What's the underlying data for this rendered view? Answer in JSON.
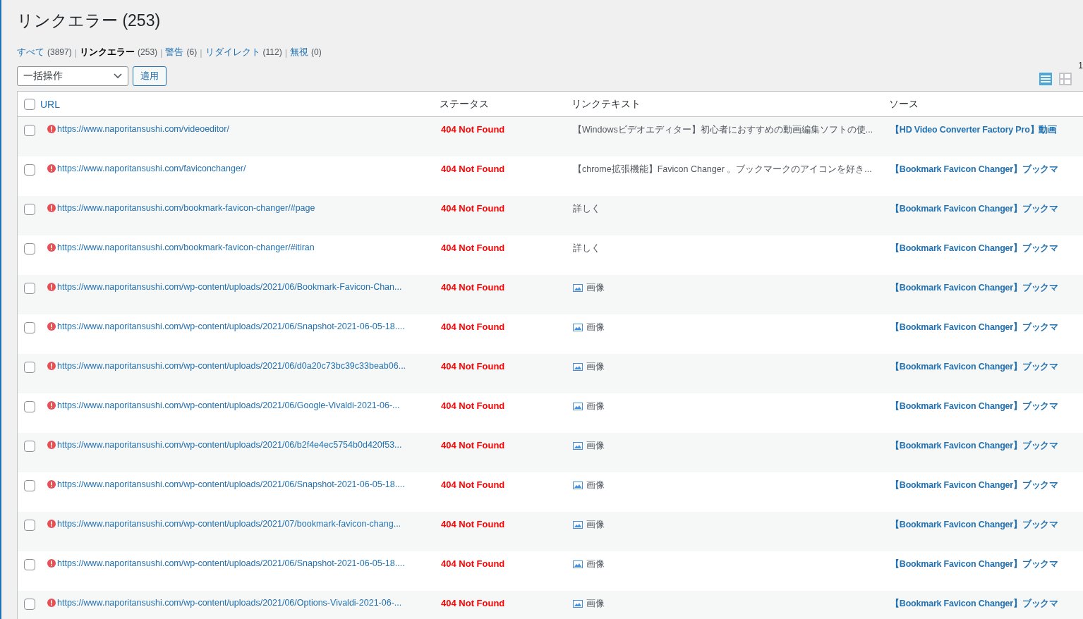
{
  "page_title": "リンクエラー (253)",
  "filters": [
    {
      "label": "すべて",
      "count": "(3897)",
      "selected": false
    },
    {
      "separator": "|",
      "label": "リンクエラー",
      "count": "(253)",
      "selected": true
    },
    {
      "separator": "|",
      "label": "警告",
      "count": "(6)",
      "selected": false
    },
    {
      "separator": "|",
      "label": "リダイレクト",
      "count": "(112)",
      "selected": false
    },
    {
      "separator": "|",
      "label": "無視",
      "count": "(0)",
      "selected": false
    }
  ],
  "bulk_action": {
    "value": "一括操作",
    "apply": "適用"
  },
  "view_modes": [
    {
      "kind": "list",
      "selected": true
    },
    {
      "kind": "excerpt",
      "selected": false
    }
  ],
  "corner_text": "1",
  "table": {
    "select_all_checked": false,
    "columns": [
      "URL",
      "ステータス",
      "リンクテキスト",
      "ソース"
    ],
    "rows": [
      {
        "checked": false,
        "url": "https://www.naporitansushi.com/videoeditor/",
        "status": "404 Not Found",
        "kind": "text",
        "link_text": "【Windowsビデオエディター】初心者におすすめの動画編集ソフトの使...",
        "source": "【HD Video Converter Factory Pro】動画"
      },
      {
        "checked": false,
        "url": "https://www.naporitansushi.com/faviconchanger/",
        "status": "404 Not Found",
        "kind": "text",
        "link_text": "【chrome拡張機能】Favicon Changer 。ブックマークのアイコンを好き...",
        "source": "【Bookmark Favicon Changer】ブックマ"
      },
      {
        "checked": false,
        "url": "https://www.naporitansushi.com/bookmark-favicon-changer/#page",
        "status": "404 Not Found",
        "kind": "text",
        "link_text": "詳しく",
        "source": "【Bookmark Favicon Changer】ブックマ"
      },
      {
        "checked": false,
        "url": "https://www.naporitansushi.com/bookmark-favicon-changer/#itiran",
        "status": "404 Not Found",
        "kind": "text",
        "link_text": "詳しく",
        "source": "【Bookmark Favicon Changer】ブックマ"
      },
      {
        "checked": false,
        "url": "https://www.naporitansushi.com/wp-content/uploads/2021/06/Bookmark-Favicon-Chan...",
        "status": "404 Not Found",
        "kind": "image",
        "link_text": "画像",
        "source": "【Bookmark Favicon Changer】ブックマ"
      },
      {
        "checked": false,
        "url": "https://www.naporitansushi.com/wp-content/uploads/2021/06/Snapshot-2021-06-05-18....",
        "status": "404 Not Found",
        "kind": "image",
        "link_text": "画像",
        "source": "【Bookmark Favicon Changer】ブックマ"
      },
      {
        "checked": false,
        "url": "https://www.naporitansushi.com/wp-content/uploads/2021/06/d0a20c73bc39c33beab06...",
        "status": "404 Not Found",
        "kind": "image",
        "link_text": "画像",
        "source": "【Bookmark Favicon Changer】ブックマ"
      },
      {
        "checked": false,
        "url": "https://www.naporitansushi.com/wp-content/uploads/2021/06/Google-Vivaldi-2021-06-...",
        "status": "404 Not Found",
        "kind": "image",
        "link_text": "画像",
        "source": "【Bookmark Favicon Changer】ブックマ"
      },
      {
        "checked": false,
        "url": "https://www.naporitansushi.com/wp-content/uploads/2021/06/b2f4e4ec5754b0d420f53...",
        "status": "404 Not Found",
        "kind": "image",
        "link_text": "画像",
        "source": "【Bookmark Favicon Changer】ブックマ"
      },
      {
        "checked": false,
        "url": "https://www.naporitansushi.com/wp-content/uploads/2021/06/Snapshot-2021-06-05-18....",
        "status": "404 Not Found",
        "kind": "image",
        "link_text": "画像",
        "source": "【Bookmark Favicon Changer】ブックマ"
      },
      {
        "checked": false,
        "url": "https://www.naporitansushi.com/wp-content/uploads/2021/07/bookmark-favicon-chang...",
        "status": "404 Not Found",
        "kind": "image",
        "link_text": "画像",
        "source": "【Bookmark Favicon Changer】ブックマ"
      },
      {
        "checked": false,
        "url": "https://www.naporitansushi.com/wp-content/uploads/2021/06/Snapshot-2021-06-05-18....",
        "status": "404 Not Found",
        "kind": "image",
        "link_text": "画像",
        "source": "【Bookmark Favicon Changer】ブックマ"
      },
      {
        "checked": false,
        "url": "https://www.naporitansushi.com/wp-content/uploads/2021/06/Options-Vivaldi-2021-06-...",
        "status": "404 Not Found",
        "kind": "image",
        "link_text": "画像",
        "source": "【Bookmark Favicon Changer】ブックマ"
      }
    ]
  }
}
